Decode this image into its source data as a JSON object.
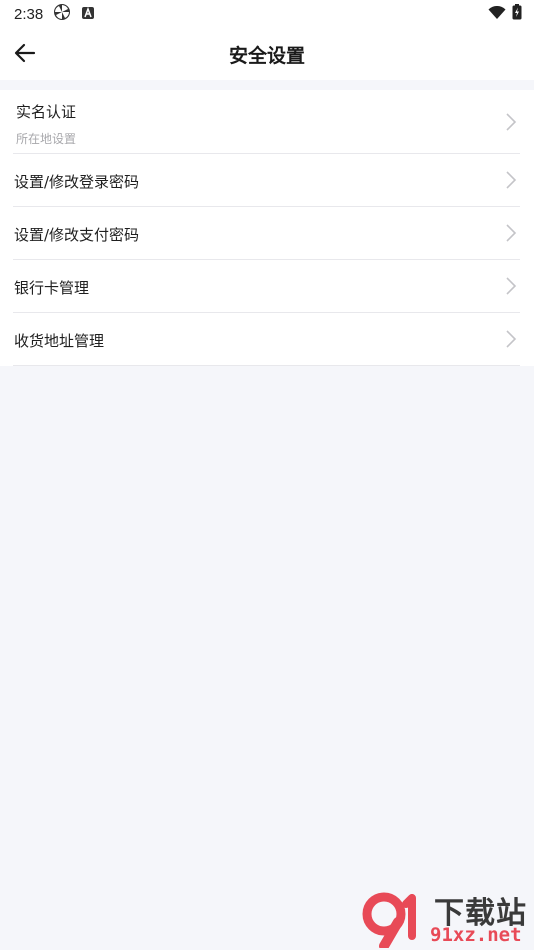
{
  "status_bar": {
    "time": "2:38",
    "left_icons": [
      "pinwheel-icon",
      "a-box-icon"
    ],
    "right_icons": [
      "wifi-icon",
      "battery-charging-icon"
    ]
  },
  "header": {
    "title": "安全设置",
    "back_icon": "arrow-left-icon"
  },
  "settings": {
    "items": [
      {
        "label": "实名认证",
        "sub": "所在地设置"
      },
      {
        "label": "设置/修改登录密码"
      },
      {
        "label": "设置/修改支付密码"
      },
      {
        "label": "银行卡管理"
      },
      {
        "label": "收货地址管理"
      }
    ]
  },
  "watermark": {
    "top": "下载站",
    "bottom": "91xz.net"
  },
  "colors": {
    "page_bg": "#f5f6fa",
    "card_bg": "#ffffff",
    "divider": "#e8e8ec",
    "subtext": "#a8a8ac",
    "watermark_red": "#e84a57"
  }
}
